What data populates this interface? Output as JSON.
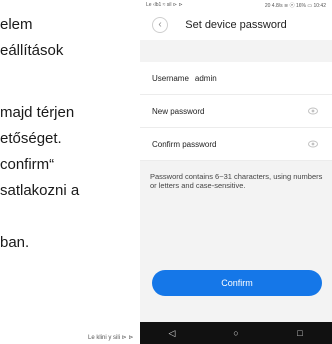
{
  "document": {
    "lines": [
      "elem",
      "eállítások",
      "majd térjen",
      "etőséget.",
      "confirm“",
      "satlakozni a",
      "ban."
    ],
    "footer": "Le klini y sili ⊳ ⊳"
  },
  "phone": {
    "status_left": "Le ‹lb1 ≈ sil ⊳ ⊳",
    "status_right": "20 4.8/s ≋ ⓔ 16% ▭ 10:42",
    "title": "Set device password",
    "username_label": "Username",
    "username_value": "admin",
    "new_password_label": "New password",
    "confirm_password_label": "Confirm password",
    "hint": "Password contains 6~31 characters, using numbers or letters and case-sensitive.",
    "confirm_button": "Confirm",
    "nav": {
      "back": "◁",
      "home": "○",
      "recent": "□"
    },
    "colors": {
      "accent": "#1577e8"
    },
    "icons": {
      "back": "chevron-left-icon",
      "eye": "eye-icon"
    }
  }
}
